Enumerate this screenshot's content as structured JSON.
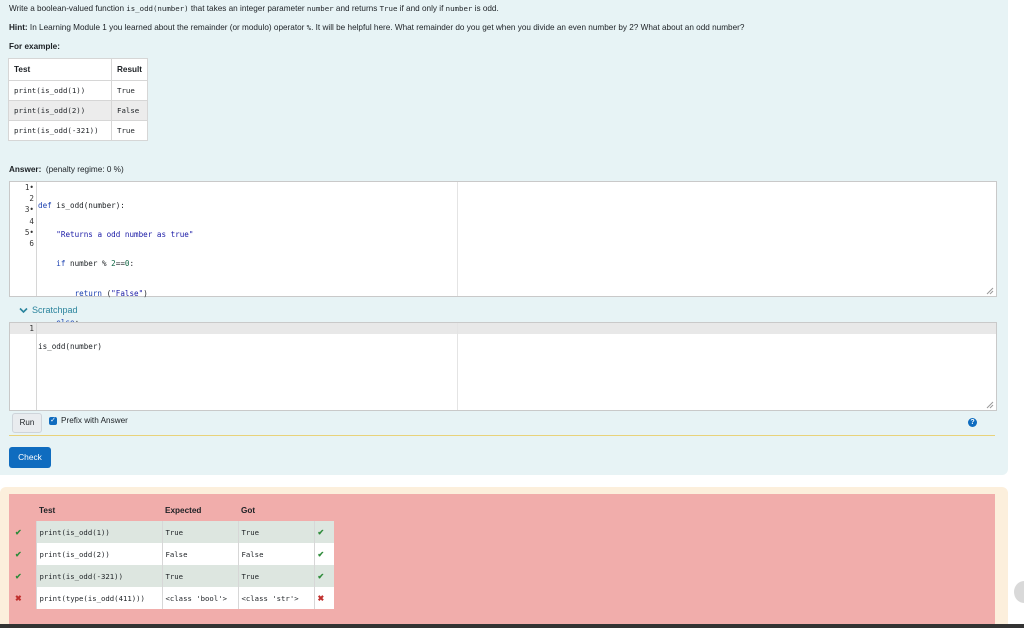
{
  "question": {
    "line1_a": "Write a boolean-valued function ",
    "line1_code1": "is_odd(number)",
    "line1_b": " that takes an integer parameter ",
    "line1_code2": "number",
    "line1_c": " and returns ",
    "line1_code3": "True",
    "line1_d": " if and only if ",
    "line1_code4": "number",
    "line1_e": " is odd.",
    "hint_label": "Hint:",
    "hint_a": " In Learning Module 1 you learned about the remainder (or modulo) operator ",
    "hint_code": "%",
    "hint_b": ". It will be helpful here. What remainder do you get when you divide an even number by 2? What about an odd number?",
    "example_label": "For example:"
  },
  "example_table": {
    "headers": [
      "Test",
      "Result"
    ],
    "rows": [
      {
        "test": "print(is_odd(1))",
        "result": "True"
      },
      {
        "test": "print(is_odd(2))",
        "result": "False"
      },
      {
        "test": "print(is_odd(-321))",
        "result": "True"
      }
    ]
  },
  "answer": {
    "label": "Answer:",
    "penalty": "(penalty regime: 0 %)",
    "line_numbers": [
      "1",
      "2",
      "3",
      "4",
      "5",
      "6"
    ]
  },
  "scratchpad": {
    "toggle_label": "Scratchpad",
    "line_number": "1",
    "code": "is_odd(number)",
    "run_label": "Run",
    "prefix_label": "Prefix with Answer",
    "help_symbol": "?"
  },
  "check_label": "Check",
  "results": {
    "headers": [
      "Test",
      "Expected",
      "Got"
    ],
    "rows": [
      {
        "test": "print(is_odd(1))",
        "expected": "True",
        "got": "True",
        "status": "pass"
      },
      {
        "test": "print(is_odd(2))",
        "expected": "False",
        "got": "False",
        "status": "pass"
      },
      {
        "test": "print(is_odd(-321))",
        "expected": "True",
        "got": "True",
        "status": "pass"
      },
      {
        "test": "print(type(is_odd(411)))",
        "expected": "<class 'bool'>",
        "got": "<class 'str'>",
        "status": "fail"
      }
    ]
  },
  "colors": {
    "question_bg": "#e7f3f5",
    "feedback_bg": "#f1adab",
    "accent": "#0f6cbf",
    "pass": "#2e8b3a",
    "fail": "#c0302e"
  }
}
